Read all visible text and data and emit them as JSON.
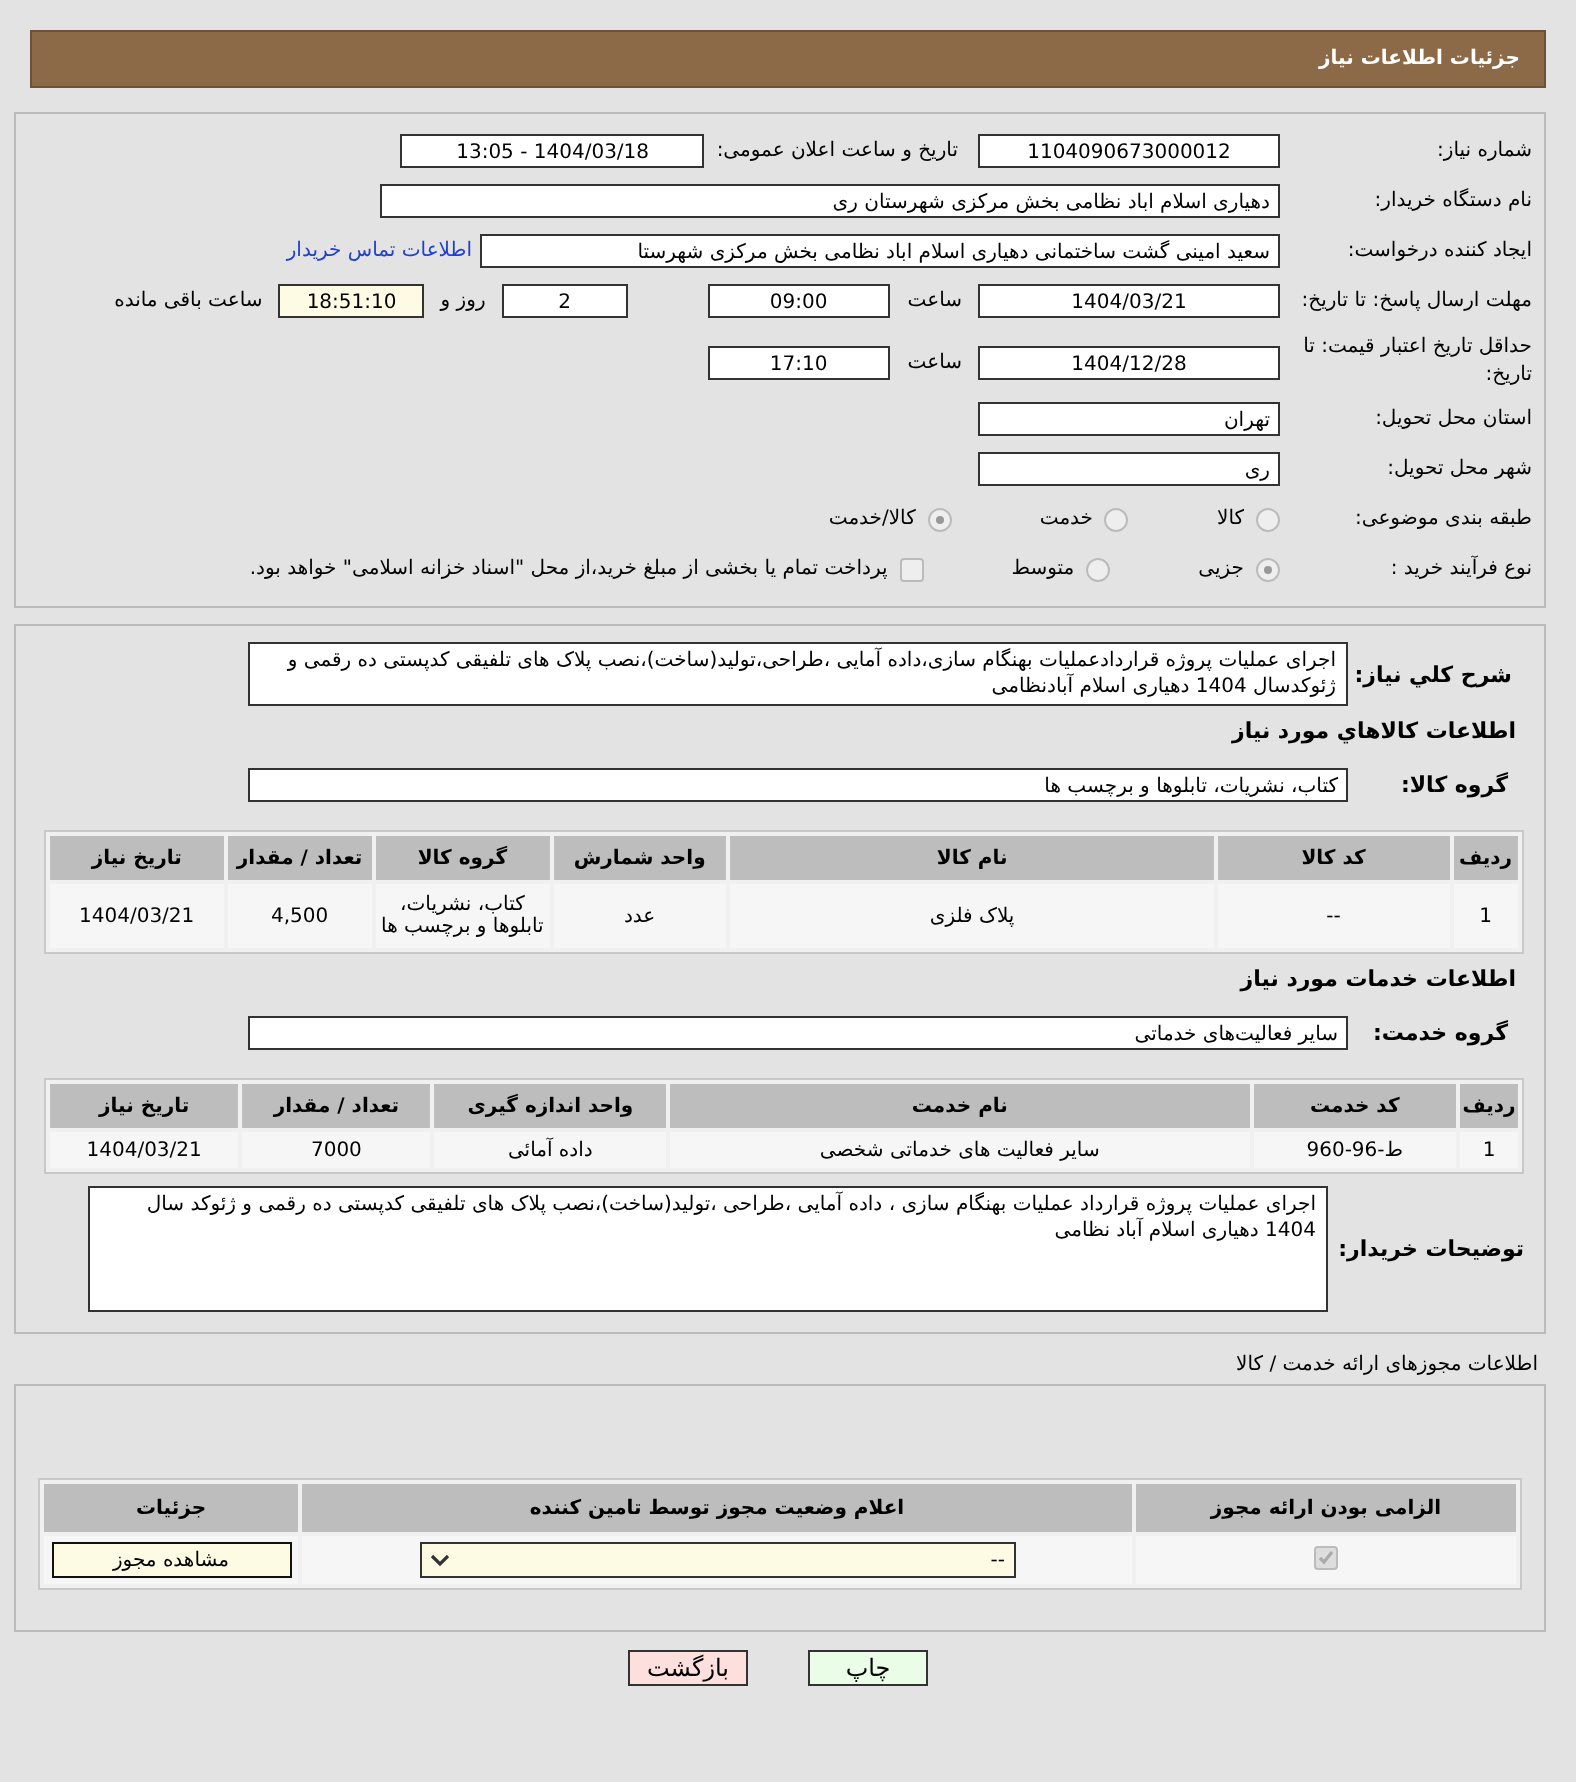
{
  "header": {
    "title": "جزئیات اطلاعات نیاز"
  },
  "details": {
    "need_number": {
      "label": "شماره نیاز:",
      "value": "1104090673000012"
    },
    "announce_datetime": {
      "label": "تاریخ و ساعت اعلان عمومی:",
      "value": "1404/03/18 - 13:05"
    },
    "buyer_org": {
      "label": "نام دستگاه خریدار:",
      "value": "دهیاری اسلام اباد نظامی بخش مرکزی شهرستان ری"
    },
    "requester": {
      "label": "ایجاد کننده درخواست:",
      "value": "سعید امینی گشت ساختمانی دهیاری اسلام اباد نظامی بخش مرکزی شهرستا",
      "link": "اطلاعات تماس خریدار"
    },
    "response_deadline": {
      "label": "مهلت ارسال پاسخ: تا تاریخ:",
      "date": "1404/03/21",
      "time_label": "ساعت",
      "time": "09:00",
      "days": "2",
      "days_label": "روز و",
      "remaining": "18:51:10",
      "remaining_label": "ساعت باقی مانده"
    },
    "price_validity": {
      "label": "حداقل تاریخ اعتبار قیمت: تا تاریخ:",
      "date": "1404/12/28",
      "time_label": "ساعت",
      "time": "17:10"
    },
    "province": {
      "label": "استان محل تحویل:",
      "value": "تهران"
    },
    "city": {
      "label": "شهر محل تحویل:",
      "value": "ری"
    },
    "category": {
      "label": "طبقه بندی موضوعی:",
      "options": [
        {
          "label": "کالا",
          "selected": false
        },
        {
          "label": "خدمت",
          "selected": false
        },
        {
          "label": "کالا/خدمت",
          "selected": true
        }
      ]
    },
    "purchase_type": {
      "label": "نوع فرآیند خرید :",
      "options": [
        {
          "label": "جزیی",
          "selected": true
        },
        {
          "label": "متوسط",
          "selected": false
        }
      ],
      "payment_note": {
        "label": "پرداخت تمام یا بخشی از مبلغ خرید،از محل \"اسناد خزانه اسلامی\" خواهد بود.",
        "checked": false
      }
    }
  },
  "description": {
    "label": "شرح کلي نياز:",
    "value": "اجرای عملیات پروژه قراردادعملیات بهنگام سازی،داده آمایی ،طراحی،تولید(ساخت)،نصب پلاک های تلفیقی کدپستی ده رقمی و ژئوکدسال 1404 دهیاری اسلام آبادنظامی"
  },
  "goods": {
    "title": "اطلاعات کالاهاي مورد نياز",
    "group_label": "گروه کالا:",
    "group": "کتاب، نشریات، تابلوها و برچسب ها",
    "columns": [
      "ردیف",
      "کد کالا",
      "نام کالا",
      "واحد شمارش",
      "گروه کالا",
      "تعداد / مقدار",
      "تاریخ نیاز"
    ],
    "rows": [
      [
        "1",
        "--",
        "پلاک فلزی",
        "عدد",
        "کتاب، نشریات، تابلوها و برچسب ها",
        "4,500",
        "1404/03/21"
      ]
    ]
  },
  "services": {
    "title": "اطلاعات خدمات مورد نیاز",
    "group_label": "گروه خدمت:",
    "group": "سایر فعالیت‌های خدماتی",
    "columns": [
      "ردیف",
      "کد خدمت",
      "نام خدمت",
      "واحد اندازه گیری",
      "تعداد / مقدار",
      "تاریخ نیاز"
    ],
    "rows": [
      [
        "1",
        "ط-96-960",
        "سایر فعالیت های خدماتی شخصی",
        "داده آمائی",
        "7000",
        "1404/03/21"
      ]
    ]
  },
  "buyer_notes": {
    "label": "توضیحات خریدار:",
    "value": "اجرای عملیات پروژه قرارداد عملیات بهنگام سازی ، داده آمایی ،طراحی ،تولید(ساخت)،نصب پلاک های تلفیقی کدپستی ده رقمی و ژئوکد سال 1404 دهیاری اسلام آباد نظامی"
  },
  "licenses": {
    "title": "اطلاعات مجوزهای ارائه خدمت / کالا",
    "columns": [
      "الزامی بودن ارائه مجوز",
      "اعلام وضعیت مجوز توسط تامین کننده",
      "جزئیات"
    ],
    "rows": [
      {
        "required": true,
        "status": "--",
        "details_button": "مشاهده مجوز"
      }
    ]
  },
  "buttons": [
    {
      "label": "چاپ",
      "kind": "print"
    },
    {
      "label": "بازگشت",
      "kind": "back"
    }
  ]
}
